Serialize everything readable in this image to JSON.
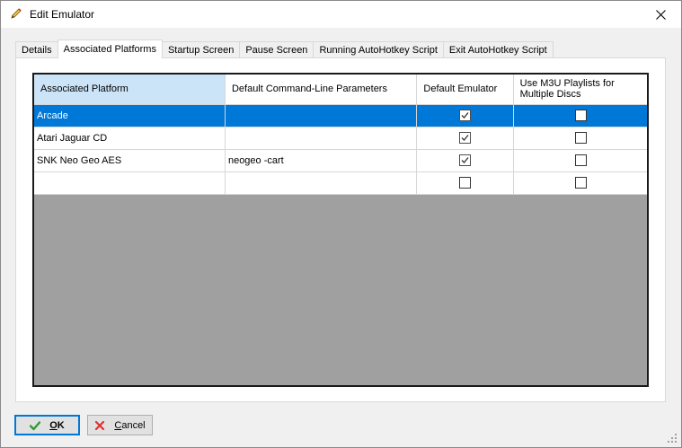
{
  "window": {
    "title": "Edit Emulator",
    "icons": {
      "title": "pencil-icon",
      "close": "close-icon"
    }
  },
  "tabs": [
    {
      "label": "Details",
      "active": false
    },
    {
      "label": "Associated Platforms",
      "active": true
    },
    {
      "label": "Startup Screen",
      "active": false
    },
    {
      "label": "Pause Screen",
      "active": false
    },
    {
      "label": "Running AutoHotkey Script",
      "active": false
    },
    {
      "label": "Exit AutoHotkey Script",
      "active": false
    }
  ],
  "grid": {
    "columns": [
      "Associated Platform",
      "Default Command-Line Parameters",
      "Default Emulator",
      "Use M3U Playlists for Multiple Discs"
    ],
    "rows": [
      {
        "platform": "Arcade",
        "params": "",
        "default_emulator": true,
        "use_m3u": false,
        "selected": true
      },
      {
        "platform": "Atari Jaguar CD",
        "params": "",
        "default_emulator": true,
        "use_m3u": false,
        "selected": false
      },
      {
        "platform": "SNK Neo Geo AES",
        "params": "neogeo -cart",
        "default_emulator": true,
        "use_m3u": false,
        "selected": false
      },
      {
        "platform": "",
        "params": "",
        "default_emulator": false,
        "use_m3u": false,
        "selected": false
      }
    ]
  },
  "buttons": {
    "ok": {
      "label_mnemonic": "O",
      "label_rest": "K",
      "icon": "checkmark-icon"
    },
    "cancel": {
      "label_mnemonic": "C",
      "label_rest": "ancel",
      "icon": "x-icon"
    }
  },
  "colors": {
    "selection": "#0078d7",
    "header_highlight": "#cce4f7",
    "grid_background": "#a0a0a0",
    "ok_icon": "#2e9e2e",
    "cancel_icon": "#e03030"
  }
}
